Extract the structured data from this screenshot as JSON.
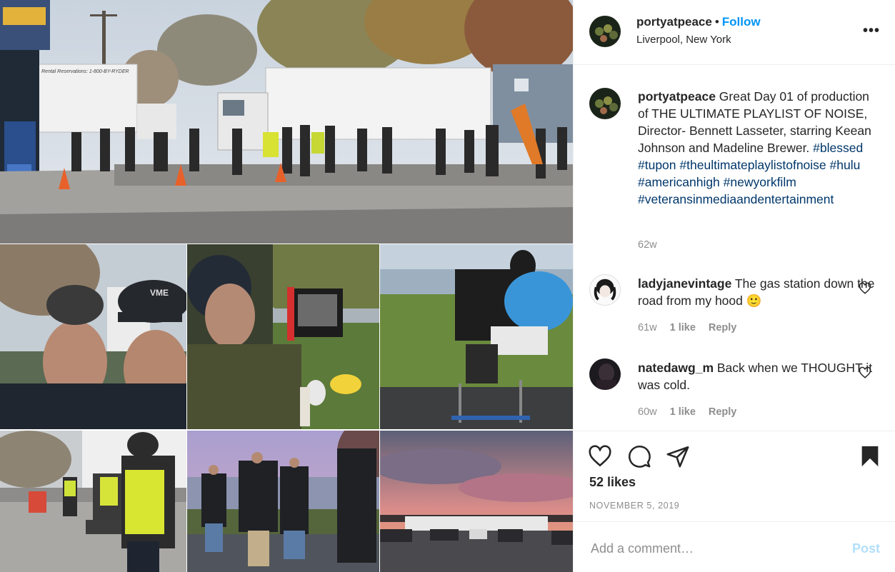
{
  "post": {
    "username": "portyatpeace",
    "separator": "•",
    "follow_label": "Follow",
    "location": "Liverpool, New York",
    "more_icon": "more-horizontal-icon",
    "caption": {
      "username": "portyatpeace",
      "text": " Great Day 01 of production of THE ULTIMATE PLAYLIST OF NOISE, Director- Bennett Lasseter, starring Keean Johnson and Madeline Brewer. ",
      "hashtags": [
        "#blessed",
        "#tupon",
        "#theultimateplaylistofnoise",
        "#hulu",
        "#americanhigh",
        "#newyorkfilm",
        "#veteransinmediaandentertainment"
      ],
      "age": "62w"
    },
    "comments": [
      {
        "username": "ladyjanevintage",
        "text": " The gas station down the road from my hood 🙂",
        "age": "61w",
        "likes": "1 like",
        "reply": "Reply"
      },
      {
        "username": "natedawg_m",
        "text": " Back when we THOUGHT it was cold.",
        "age": "60w",
        "likes": "1 like",
        "reply": "Reply"
      }
    ],
    "likes_count": "52 likes",
    "date": "NOVEMBER 5, 2019",
    "add_comment_placeholder": "Add a comment…",
    "post_button": "Post",
    "icons": [
      "heart-icon",
      "comment-icon",
      "share-icon",
      "bookmark-icon"
    ],
    "colors": {
      "link": "#0095f6",
      "hashtag": "#00376b",
      "muted": "#8e8e8e",
      "post_disabled": "#b2dffc"
    }
  },
  "media": {
    "photos": [
      {
        "name": "film-crew-gas-station",
        "truck_sign": "Rental Reservations: 1-800-BY-RYDER"
      },
      {
        "name": "selfie-two-men",
        "hat_text": "VME"
      },
      {
        "name": "crew-monitor-lake"
      },
      {
        "name": "camera-operator-lake"
      },
      {
        "name": "crew-vests-truck"
      },
      {
        "name": "crew-dusk-lake"
      },
      {
        "name": "sunset-parking-lot"
      }
    ]
  }
}
